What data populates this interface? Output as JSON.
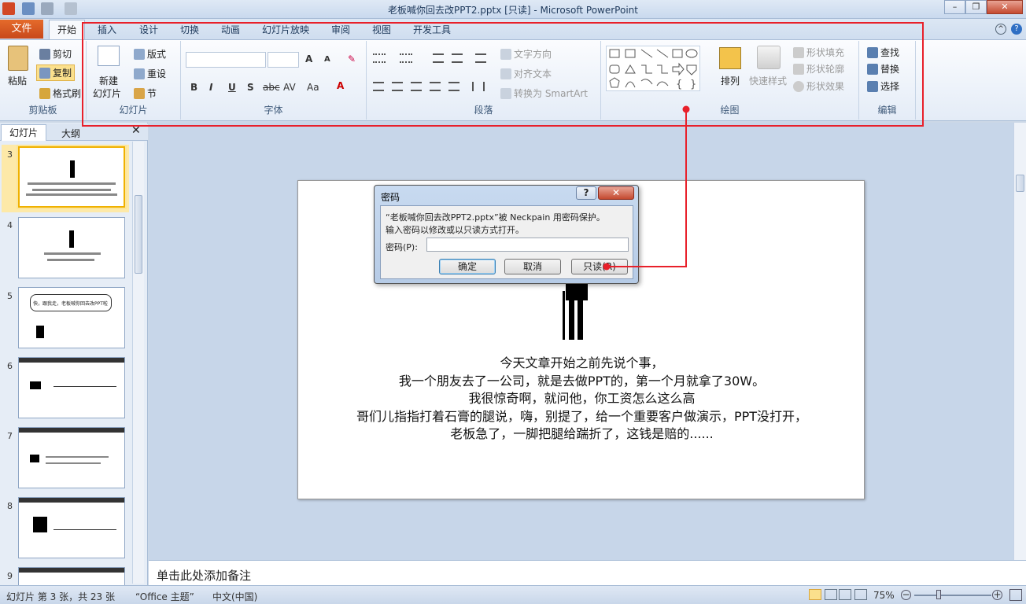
{
  "window": {
    "title": "老板喊你回去改PPT2.pptx [只读]  -  Microsoft PowerPoint"
  },
  "tabs": {
    "file": "文件",
    "home": "开始",
    "items": [
      "插入",
      "设计",
      "切换",
      "动画",
      "幻灯片放映",
      "审阅",
      "视图",
      "开发工具"
    ]
  },
  "ribbon": {
    "clipboard": {
      "paste": "粘贴",
      "cut": "剪切",
      "copy": "复制",
      "format_painter": "格式刷",
      "label": "剪贴板"
    },
    "slides": {
      "new_slide": "新建",
      "new_slide2": "幻灯片",
      "layout": "版式",
      "reset": "重设",
      "section": "节",
      "label": "幻灯片"
    },
    "font": {
      "label": "字体"
    },
    "paragraph": {
      "text_direction": "文字方向",
      "align_text": "对齐文本",
      "smartart": "转换为 SmartArt",
      "label": "段落"
    },
    "drawing": {
      "arrange": "排列",
      "quick_styles": "快速样式",
      "shape_fill": "形状填充",
      "shape_outline": "形状轮廓",
      "shape_effects": "形状效果",
      "label": "绘图"
    },
    "editing": {
      "find": "查找",
      "replace": "替换",
      "select": "选择",
      "label": "编辑"
    }
  },
  "panel": {
    "tab_slides": "幻灯片",
    "tab_outline": "大纲",
    "slide_numbers": [
      "3",
      "4",
      "5",
      "6",
      "7",
      "8",
      "9"
    ],
    "thumb5_text": "快，跟我走，老板喊你回去改PPT啦"
  },
  "slide": {
    "lines": [
      "今天文章开始之前先说个事，",
      "我一个朋友去了一公司，就是去做PPT的，第一个月就拿了30W。",
      "我很惊奇啊，就问他，你工资怎么这么高",
      "哥们儿指指打着石膏的腿说，嗨，别提了，给一个重要客户做演示，PPT没打开，",
      "老板急了，一脚把腿给踹折了，这钱是赔的......"
    ]
  },
  "dialog": {
    "title": "密码",
    "message1": "“老板喊你回去改PPT2.pptx”被 Neckpain 用密码保护。",
    "message2": "输入密码以修改或以只读方式打开。",
    "password_label": "密码(P):",
    "password_value": "",
    "ok": "确定",
    "cancel": "取消",
    "readonly": "只读(R)"
  },
  "notes": {
    "placeholder": "单击此处添加备注"
  },
  "status": {
    "slide_info": "幻灯片 第 3 张，共 23 张",
    "theme": "“Office 主题”",
    "language": "中文(中国)",
    "zoom": "75%"
  },
  "colors": {
    "annotation": "#e8202a",
    "file_tab": "#d4571f",
    "selected_thumb": "#f0b100"
  }
}
